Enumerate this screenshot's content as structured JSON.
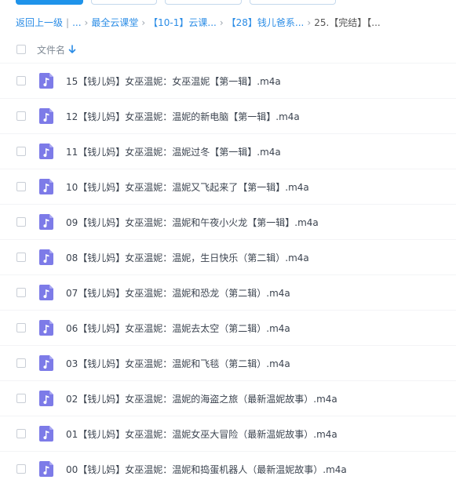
{
  "breadcrumb": {
    "back": "返回上一级",
    "ellipsis": "...",
    "items": [
      "最全云课堂",
      "【10-1】云课...",
      "【28】钱儿爸系...",
      "25.【完结】【..."
    ]
  },
  "list_header": {
    "column_name": "文件名",
    "sort_icon": "arrow-down-icon"
  },
  "files": [
    {
      "name": "15【钱儿妈】女巫温妮：女巫温妮【第一辑】.m4a"
    },
    {
      "name": "12【钱儿妈】女巫温妮：温妮的新电脑【第一辑】.m4a"
    },
    {
      "name": "11【钱儿妈】女巫温妮：温妮过冬【第一辑】.m4a"
    },
    {
      "name": "10【钱儿妈】女巫温妮：温妮又飞起来了【第一辑】.m4a"
    },
    {
      "name": "09【钱儿妈】女巫温妮：温妮和午夜小火龙【第一辑】.m4a"
    },
    {
      "name": "08【钱儿妈】女巫温妮：温妮，生日快乐（第二辑）.m4a"
    },
    {
      "name": "07【钱儿妈】女巫温妮：温妮和恐龙（第二辑）.m4a"
    },
    {
      "name": "06【钱儿妈】女巫温妮：温妮去太空（第二辑）.m4a"
    },
    {
      "name": "03【钱儿妈】女巫温妮：温妮和飞毯（第二辑）.m4a"
    },
    {
      "name": "02【钱儿妈】女巫温妮：温妮的海盗之旅（最新温妮故事）.m4a"
    },
    {
      "name": "01【钱儿妈】女巫温妮：温妮女巫大冒险（最新温妮故事）.m4a"
    },
    {
      "name": "00【钱儿妈】女巫温妮：温妮和捣蛋机器人（最新温妮故事）.m4a"
    }
  ],
  "colors": {
    "accent": "#2a8ce6",
    "audio_icon": "#7d7be8"
  },
  "file_icon": "audio-file-icon"
}
